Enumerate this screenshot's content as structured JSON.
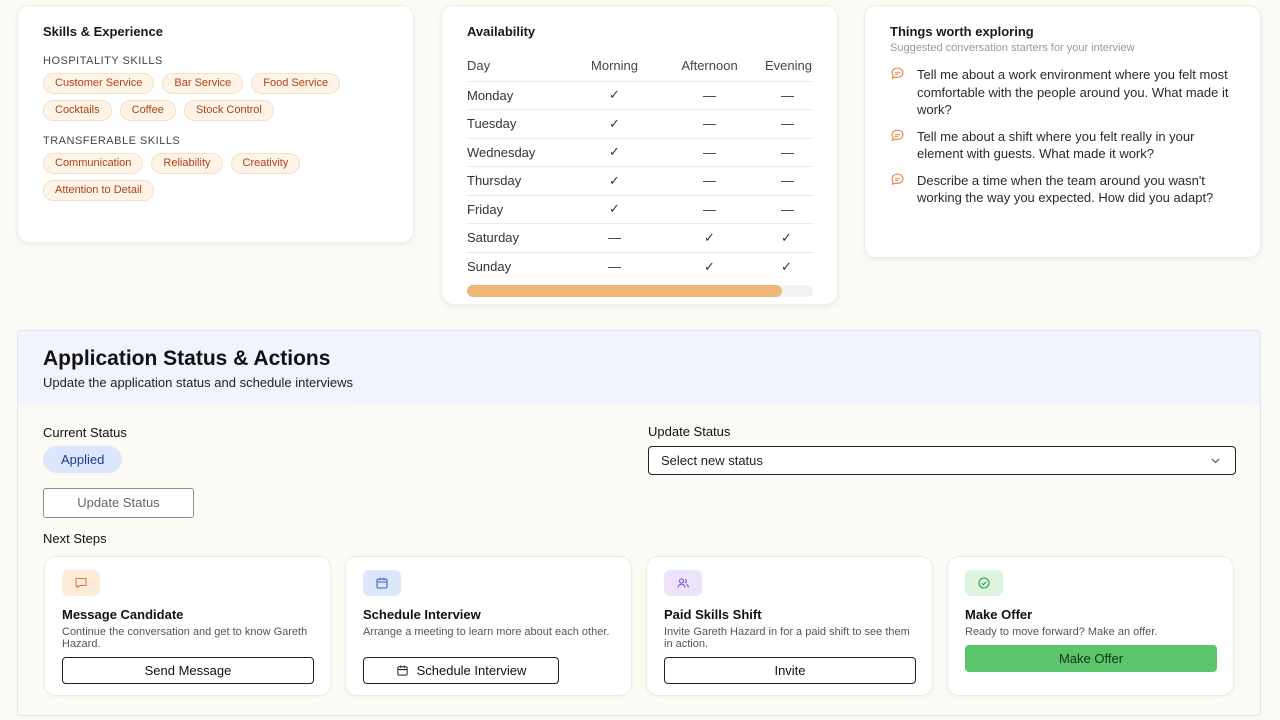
{
  "skills": {
    "title": "Skills & Experience",
    "hospitality_heading": "HOSPITALITY SKILLS",
    "hospitality": [
      "Customer Service",
      "Bar Service",
      "Food Service",
      "Cocktails",
      "Coffee",
      "Stock Control"
    ],
    "transferable_heading": "TRANSFERABLE SKILLS",
    "transferable": [
      "Communication",
      "Reliability",
      "Creativity",
      "Attention to Detail"
    ]
  },
  "availability": {
    "title": "Availability",
    "columns": [
      "Day",
      "Morning",
      "Afternoon",
      "Evening"
    ],
    "rows": [
      {
        "day": "Monday",
        "morning": "✓",
        "afternoon": "—",
        "evening": "—"
      },
      {
        "day": "Tuesday",
        "morning": "✓",
        "afternoon": "—",
        "evening": "—"
      },
      {
        "day": "Wednesday",
        "morning": "✓",
        "afternoon": "—",
        "evening": "—"
      },
      {
        "day": "Thursday",
        "morning": "✓",
        "afternoon": "—",
        "evening": "—"
      },
      {
        "day": "Friday",
        "morning": "✓",
        "afternoon": "—",
        "evening": "—"
      },
      {
        "day": "Saturday",
        "morning": "—",
        "afternoon": "✓",
        "evening": "✓"
      },
      {
        "day": "Sunday",
        "morning": "—",
        "afternoon": "✓",
        "evening": "✓"
      }
    ],
    "scroll_fraction": 0.91
  },
  "exploring": {
    "title": "Things worth exploring",
    "subtitle": "Suggested conversation starters for your interview",
    "questions": [
      "Tell me about a work environment where you felt most comfortable with the people around you. What made it work?",
      "Tell me about a shift where you felt really in your element with guests. What made it work?",
      "Describe a time when the team around you wasn't working the way you expected. How did you adapt?"
    ]
  },
  "status": {
    "title": "Application Status & Actions",
    "subtitle": "Update the application status and schedule interviews",
    "current_label": "Current Status",
    "current_value": "Applied",
    "update_label": "Update Status",
    "select_placeholder": "Select new status",
    "update_button": "Update Status",
    "next_steps_label": "Next Steps",
    "steps": [
      {
        "title": "Message Candidate",
        "desc": "Continue the conversation and get to know Gareth Hazard.",
        "button": "Send Message"
      },
      {
        "title": "Schedule Interview",
        "desc": "Arrange a meeting to learn more about each other.",
        "button": "Schedule Interview"
      },
      {
        "title": "Paid Skills Shift",
        "desc": "Invite Gareth Hazard in for a paid shift to see them in action.",
        "button": "Invite"
      },
      {
        "title": "Make Offer",
        "desc": "Ready to move forward? Make an offer.",
        "button": "Make Offer"
      }
    ]
  },
  "colors": {
    "chip_text": "#b34016",
    "check": "#4fb062",
    "primary_button": "#5cc46a",
    "applied_pill": "#dce7fd",
    "scroll_thumb": "#efb777"
  }
}
